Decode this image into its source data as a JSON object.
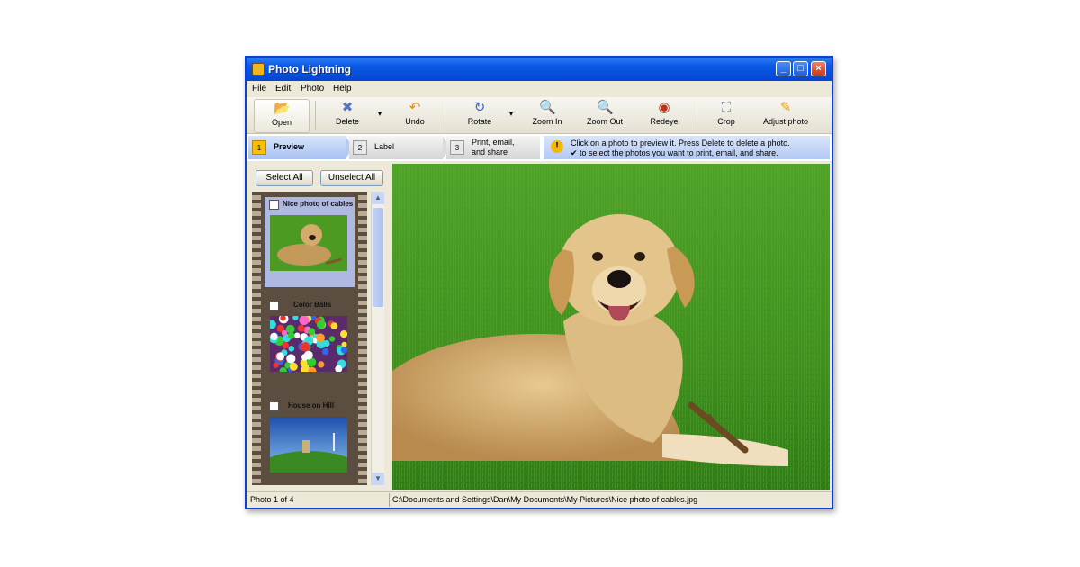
{
  "window": {
    "title": "Photo Lightning",
    "controls": {
      "minimize": "_",
      "maximize": "□",
      "close": "×"
    }
  },
  "menu": [
    "File",
    "Edit",
    "Photo",
    "Help"
  ],
  "toolbar": {
    "open": "Open",
    "delete": "Delete",
    "undo": "Undo",
    "rotate": "Rotate",
    "zoom_in": "Zoom In",
    "zoom_out": "Zoom Out",
    "redeye": "Redeye",
    "crop": "Crop",
    "adjust_photo": "Adjust photo",
    "dropdown": "▾"
  },
  "steps": {
    "preview": {
      "num": "1",
      "label": "Preview"
    },
    "label": {
      "num": "2",
      "label": "Label"
    },
    "print": {
      "num": "3",
      "label_line1": "Print, email,",
      "label_line2": "and share"
    }
  },
  "hint": {
    "line1": "Click on a photo to preview it. Press Delete to delete a photo.",
    "line2": "✔ to select the photos you want to print, email, and share."
  },
  "left_panel": {
    "select_all": "Select All",
    "unselect_all": "Unselect All",
    "thumbnails": [
      {
        "caption": "Nice photo of cables",
        "selected": true
      },
      {
        "caption": "Color Balls",
        "selected": false
      },
      {
        "caption": "House on Hill",
        "selected": false
      }
    ]
  },
  "status": {
    "count": "Photo 1 of 4",
    "path": "C:\\Documents and Settings\\Dan\\My Documents\\My Pictures\\Nice photo of cables.jpg"
  },
  "colors": {
    "titlebar": "#0a5ae6",
    "window_bg": "#ece9d8",
    "grass": "#3f8e1e",
    "step_active": "#a9c2f2"
  }
}
